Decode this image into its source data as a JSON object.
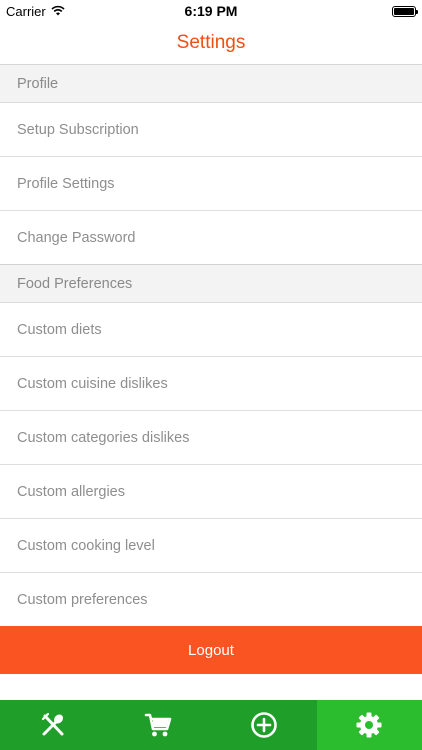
{
  "status_bar": {
    "carrier": "Carrier",
    "time": "6:19 PM",
    "battery_level": 1.0
  },
  "nav": {
    "title": "Settings"
  },
  "sections": {
    "profile": {
      "header": "Profile",
      "items": [
        {
          "label": "Setup Subscription"
        },
        {
          "label": "Profile Settings"
        },
        {
          "label": "Change Password"
        }
      ]
    },
    "food_preferences": {
      "header": "Food Preferences",
      "items": [
        {
          "label": "Custom diets"
        },
        {
          "label": "Custom cuisine dislikes"
        },
        {
          "label": "Custom categories dislikes"
        },
        {
          "label": "Custom allergies"
        },
        {
          "label": "Custom cooking level"
        },
        {
          "label": "Custom preferences"
        }
      ]
    }
  },
  "logout": {
    "label": "Logout"
  },
  "tab_bar": {
    "tabs": [
      {
        "icon": "fork-spoon-icon",
        "active": false
      },
      {
        "icon": "cart-icon",
        "active": false
      },
      {
        "icon": "add-circle-icon",
        "active": false
      },
      {
        "icon": "gear-icon",
        "active": true
      }
    ]
  },
  "colors": {
    "accent": "#f04e16",
    "logout": "#fb5423",
    "tab_bar": "#1f9e29",
    "tab_active": "#2bbd2d"
  }
}
